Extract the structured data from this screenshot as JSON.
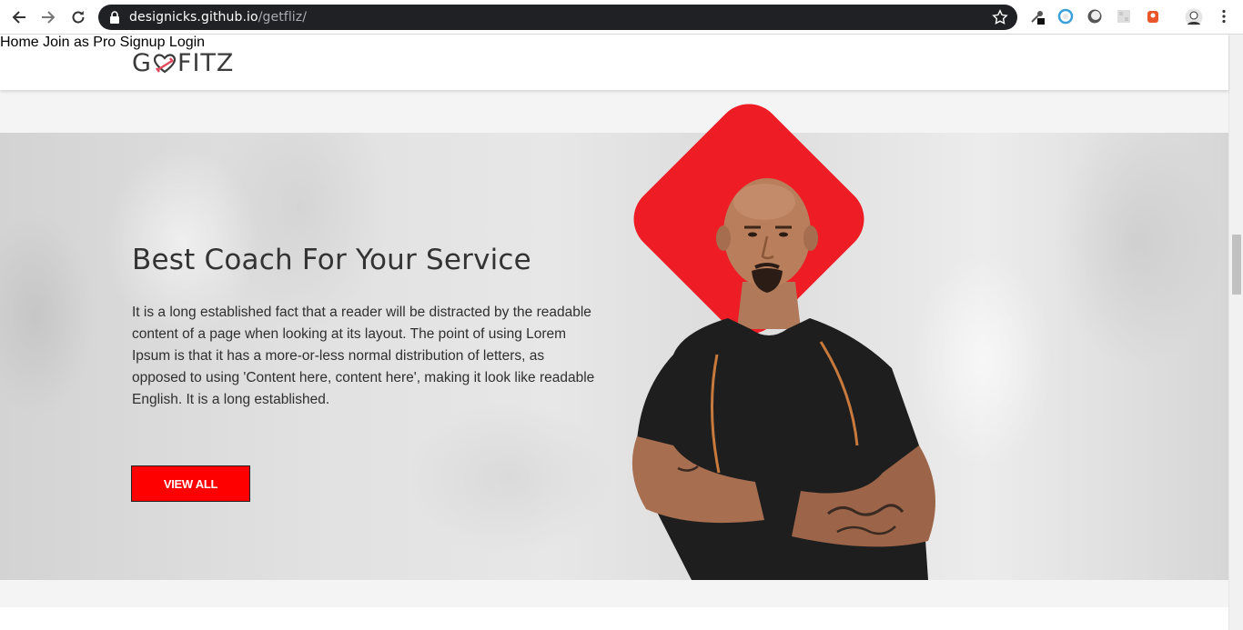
{
  "browser": {
    "url_host": "designicks.github.io",
    "url_path": "/getfliz/"
  },
  "site": {
    "logo_left": "G",
    "logo_right": "FITZ",
    "nav": [
      "Home",
      "Join as Pro",
      "Signup",
      "Login"
    ]
  },
  "hero": {
    "title": "Best Coach For Your Service",
    "paragraph": "It is a long established fact that a reader will be distracted by the readable content of a page when looking at its layout. The point of using Lorem Ipsum is that it has a more-or-less normal distribution of letters, as opposed to using 'Content here, content here', making it look like readable English. It is a long established.",
    "button": "VIEW ALL"
  },
  "colors": {
    "accent": "#ee1c24",
    "button": "#ff0000",
    "text": "#333333"
  },
  "icons": [
    "back-arrow-icon",
    "forward-arrow-icon",
    "reload-icon",
    "lock-icon",
    "star-icon",
    "menu-dots-icon"
  ]
}
